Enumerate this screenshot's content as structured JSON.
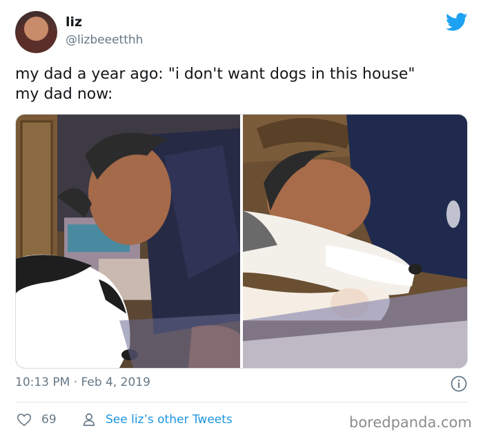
{
  "author": {
    "name": "liz",
    "handle": "@lizbeeetthh"
  },
  "tweet": {
    "text": "my dad a year ago: \"i don't want dogs in this house\"\nmy dad now:",
    "timestamp": "10:13 PM · Feb 4, 2019"
  },
  "actions": {
    "like_count": "69",
    "other_tweets_label": "See liz’s other Tweets"
  },
  "watermark": "boredpanda.com",
  "colors": {
    "twitter_blue": "#1da1f2",
    "link_blue": "#1b95e0",
    "secondary_text": "#657786"
  },
  "icons": {
    "brand": "twitter-bird-icon",
    "info": "info-icon",
    "like": "heart-icon",
    "profile": "person-icon"
  }
}
